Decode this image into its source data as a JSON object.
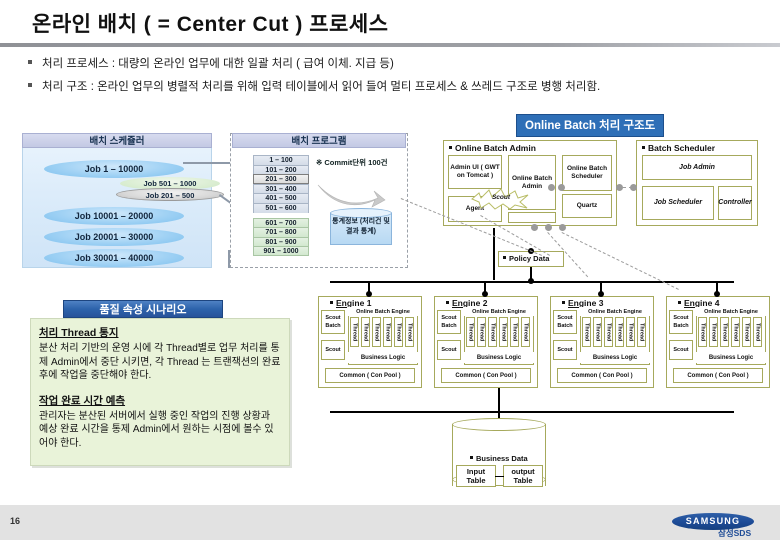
{
  "slide": {
    "title": "온라인 배치 ( = Center Cut ) 프로세스",
    "page_number": "16",
    "bullets": [
      "처리 프로세스 : 대량의 온라인 업무에 대한 일괄 처리 ( 급여 이체. 지급 등)",
      "처리 구조 : 온라인 업무의 병렬적 처리를 위해 입력 테이블에서 읽어 들여 멀티 프로세스 & 쓰레드 구조로 병행 처리함."
    ]
  },
  "badges": {
    "online_batch_diagram": "Online Batch 처리 구조도"
  },
  "batch_scheduler_panel": {
    "header": "배치 스케쥴러",
    "jobs": [
      "Job 1 – 10000",
      "Job 10001 – 20000",
      "Job 20001 – 30000",
      "Job 30001 – 40000"
    ],
    "sub_jobs": [
      "Job 501 – 1000",
      "Job 201 – 500"
    ]
  },
  "batch_program_panel": {
    "header": "배치 프로그램",
    "ranges": [
      "1 – 100",
      "101 – 200",
      "201 – 300",
      "301 – 400",
      "401 – 500",
      "501 – 600",
      "601 – 700",
      "701 – 800",
      "801 – 900",
      "901 – 1000"
    ],
    "selected_range": "201 – 300",
    "commit_note": "※ Commit단위 100건",
    "stat_cylinder": "통계정보 (처리건 및 결과 통계)"
  },
  "quality_scenario": {
    "header": "품질 속성 시나리오",
    "sections": [
      {
        "heading": "처리 Thread 통지",
        "body": "분산 처리 기반의 운영 시에 각 Thread별로 업무 처리를 통제 Admin에서 중단 시키면, 각 Thread 는 트랜잭션의 완료 후에 작업을 중단해야 한다."
      },
      {
        "heading": "작업 완료 시간 예측",
        "body": "관리자는 분산된 서버에서 실행 중인 작업의 진행 상황과 예상 완료 시간을 통제 Admin에서 원하는 시점에 볼수 있어야 한다."
      }
    ]
  },
  "architecture": {
    "online_batch_admin": {
      "title": "Online Batch Admin",
      "cells": [
        "Admin UI ( GWT on Tomcat )",
        "Online Batch Admin",
        "Online Batch Scheduler",
        "Quartz",
        "Agent"
      ],
      "burst_label": "Scout"
    },
    "batch_scheduler": {
      "title": "Batch Scheduler",
      "cells": [
        "Job Admin",
        "Job Scheduler",
        "Controller"
      ]
    },
    "policy_data": {
      "label": "Policy Data"
    },
    "engines": [
      {
        "title": "Engine 1"
      },
      {
        "title": "Engine 2"
      },
      {
        "title": "Engine 3"
      },
      {
        "title": "Engine 4"
      }
    ],
    "engine_template": {
      "engine_box_label": "Online Batch Engine",
      "thread_label": "Thread",
      "thread_count": 6,
      "business_logic": "Business Logic",
      "common_pool": "Common ( Con Pool )",
      "scout_batch": "Scout Batch",
      "scout": "Scout"
    },
    "business_data": {
      "label": "Business Data",
      "tables": [
        "Input Table",
        "output Table"
      ]
    }
  },
  "footer": {
    "brand": "SAMSUNG",
    "sub_brand": "삼성SDS"
  }
}
